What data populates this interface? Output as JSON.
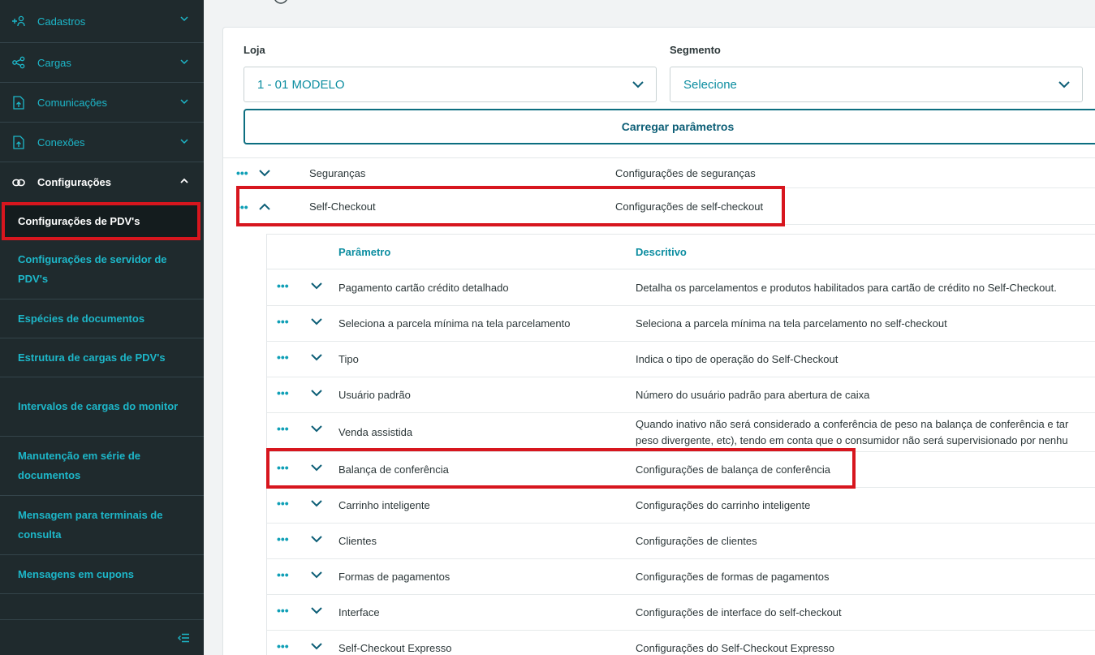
{
  "sidebar": {
    "items": [
      {
        "label": "Cadastros",
        "icon": "add-user-icon"
      },
      {
        "label": "Cargas",
        "icon": "share-icon"
      },
      {
        "label": "Comunicações",
        "icon": "file-upload-icon"
      },
      {
        "label": "Conexões",
        "icon": "file-upload-icon"
      },
      {
        "label": "Configurações",
        "icon": "link-icon"
      }
    ],
    "sub_items": [
      "Configurações de PDV's",
      "Configurações de servidor de PDV's",
      "Espécies de documentos",
      "Estrutura de cargas de PDV's",
      "Intervalos de cargas do monitor",
      "Manutenção em série de documentos",
      "Mensagem para terminais de consulta",
      "Mensagens em cupons"
    ]
  },
  "filters": {
    "loja_label": "Loja",
    "loja_value": "1 - 01 MODELO",
    "segmento_label": "Segmento",
    "segmento_value": "Selecione",
    "load_button": "Carregar parâmetros"
  },
  "groups": [
    {
      "name": "Seguranças",
      "desc": "Configurações de seguranças"
    },
    {
      "name": "Self-Checkout",
      "desc": "Configurações de self-checkout"
    }
  ],
  "subgrid": {
    "col_param": "Parâmetro",
    "col_desc": "Descritivo",
    "rows": [
      {
        "p": "Pagamento cartão crédito detalhado",
        "d": "Detalha os parcelamentos e produtos habilitados para cartão de crédito no Self-Checkout."
      },
      {
        "p": "Seleciona a parcela mínima na tela parcelamento",
        "d": "Seleciona a parcela mínima na tela parcelamento no self-checkout"
      },
      {
        "p": "Tipo",
        "d": "Indica o tipo de operação do Self-Checkout"
      },
      {
        "p": "Usuário padrão",
        "d": "Número do usuário padrão para abertura de caixa"
      },
      {
        "p": "Venda assistida",
        "d": "Quando inativo não será considerado a conferência de peso na balança de conferência e tar",
        "d2": "peso divergente, etc), tendo em conta que o consumidor não será supervisionado por nenhu"
      },
      {
        "p": "Balança de conferência",
        "d": "Configurações de balança de conferência"
      },
      {
        "p": "Carrinho inteligente",
        "d": "Configurações do carrinho inteligente"
      },
      {
        "p": "Clientes",
        "d": "Configurações de clientes"
      },
      {
        "p": "Formas de pagamentos",
        "d": "Configurações de formas de pagamentos"
      },
      {
        "p": "Interface",
        "d": "Configurações de interface do self-checkout"
      },
      {
        "p": "Self-Checkout Expresso",
        "d": "Configurações do Self-Checkout Expresso"
      }
    ]
  },
  "colors": {
    "accent": "#0c8da0",
    "highlight": "#d7161e",
    "sidebar_bg": "#1f2a2d"
  }
}
